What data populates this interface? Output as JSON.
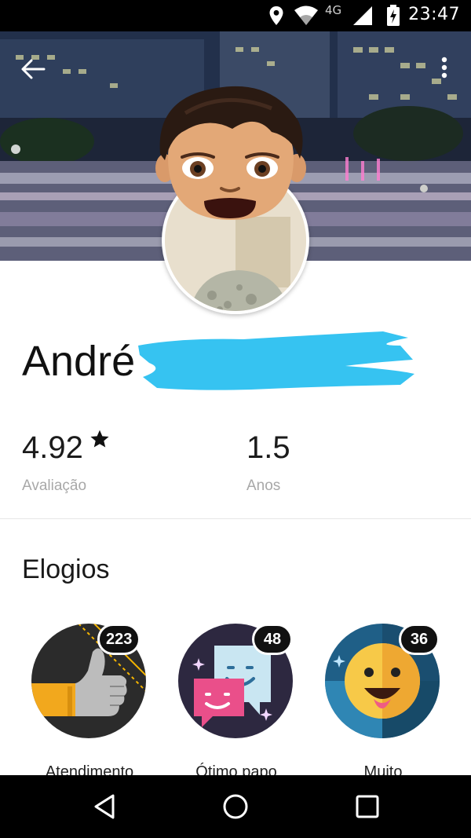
{
  "status_bar": {
    "time": "23:47",
    "network": "4G",
    "icons": [
      "location-icon",
      "wifi-icon",
      "signal-icon",
      "battery-charging-icon"
    ]
  },
  "header": {
    "back_icon": "arrow-back-icon",
    "more_icon": "more-vertical-icon"
  },
  "profile": {
    "name": "André",
    "rating": {
      "value": "4.92",
      "label": "Avaliação",
      "icon": "star-icon"
    },
    "years": {
      "value": "1.5",
      "label": "Anos"
    }
  },
  "compliments": {
    "title": "Elogios",
    "items": [
      {
        "label": "Atendimento",
        "count": "223",
        "icon": "thumbs-up-icon",
        "color": "#2b2b2b"
      },
      {
        "label": "Ótimo papo",
        "count": "48",
        "icon": "chat-bubbles-icon",
        "color": "#2d2840"
      },
      {
        "label": "Muito",
        "count": "36",
        "icon": "smiley-icon",
        "color": "#1f5f87"
      }
    ]
  },
  "nav_bar": {
    "icons": [
      "nav-back-icon",
      "nav-home-icon",
      "nav-recents-icon"
    ]
  },
  "colors": {
    "redaction": "#36c3f1",
    "status_bg": "#000000",
    "nav_bg": "#000000"
  }
}
